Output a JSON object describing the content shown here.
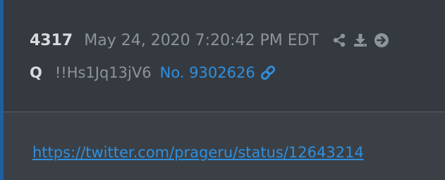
{
  "post": {
    "number": "4317",
    "timestamp": "May 24, 2020 7:20:42 PM EDT",
    "author": "Q",
    "tripcode": "!!Hs1Jq13jV6",
    "post_ref": "No. 9302626",
    "body_link": "https://twitter.com/prageru/status/12643214"
  },
  "icons": {
    "share": "share-icon",
    "download": "download-icon",
    "goto": "arrow-circle-right-icon",
    "link": "link-icon"
  },
  "colors": {
    "header_bg": "#353a40",
    "body_bg": "#3b4046",
    "accent": "#1f5fa0",
    "link": "#2f8fdf",
    "muted_text": "#8e949b",
    "bright_text": "#d8dadc"
  }
}
